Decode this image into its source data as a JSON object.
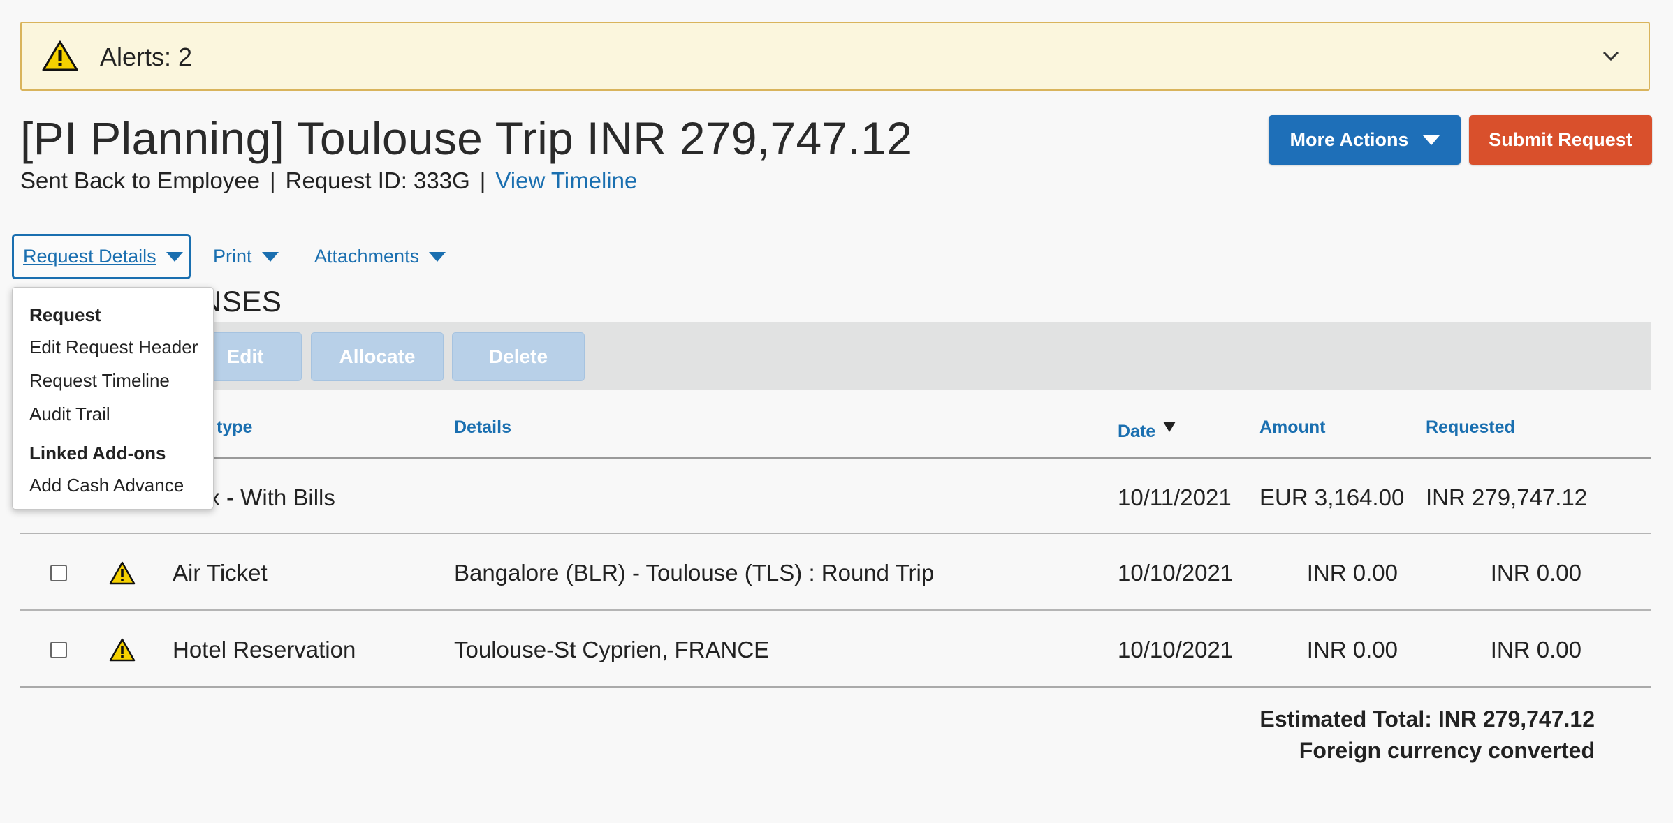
{
  "alert": {
    "text": "Alerts: 2"
  },
  "header": {
    "title": "[PI Planning] Toulouse Trip INR 279,747.12",
    "status": "Sent Back to Employee",
    "separator": "|",
    "request_id": "Request ID: 333G",
    "timeline_link": "View Timeline"
  },
  "actions": {
    "more_actions": "More Actions",
    "submit": "Submit Request"
  },
  "menubar": {
    "request_details": "Request Details",
    "print": "Print",
    "attachments": "Attachments"
  },
  "expenses": {
    "heading_visible": "PENSES",
    "toolbar": {
      "edit": "Edit",
      "allocate": "Allocate",
      "delete": "Delete"
    },
    "columns": {
      "expense_type_visible": "nse type",
      "details": "Details",
      "date": "Date",
      "amount": "Amount",
      "requested": "Requested"
    },
    "rows": [
      {
        "type_visible": "ex - With Bills",
        "details": "",
        "date": "10/11/2021",
        "amount": "EUR 3,164.00",
        "requested": "INR 279,747.12"
      },
      {
        "type": "Air Ticket",
        "details": "Bangalore (BLR) - Toulouse (TLS) : Round Trip",
        "date": "10/10/2021",
        "amount": "INR 0.00",
        "requested": "INR 0.00"
      },
      {
        "type": "Hotel Reservation",
        "details": "Toulouse-St Cyprien, FRANCE",
        "date": "10/10/2021",
        "amount": "INR 0.00",
        "requested": "INR 0.00"
      }
    ],
    "total": "Estimated Total: INR 279,747.12",
    "total_note": "Foreign currency converted"
  },
  "dropdown": {
    "section1": "Request",
    "items1": [
      "Edit Request Header",
      "Request Timeline",
      "Audit Trail"
    ],
    "section2": "Linked Add-ons",
    "items2": [
      "Add Cash Advance"
    ]
  },
  "colors": {
    "link_blue": "#1a6fb0",
    "primary_blue": "#1e6fb8",
    "submit_orange": "#d9502c",
    "alert_bg": "#fbf6dd",
    "warning_yellow": "#f5d000"
  }
}
